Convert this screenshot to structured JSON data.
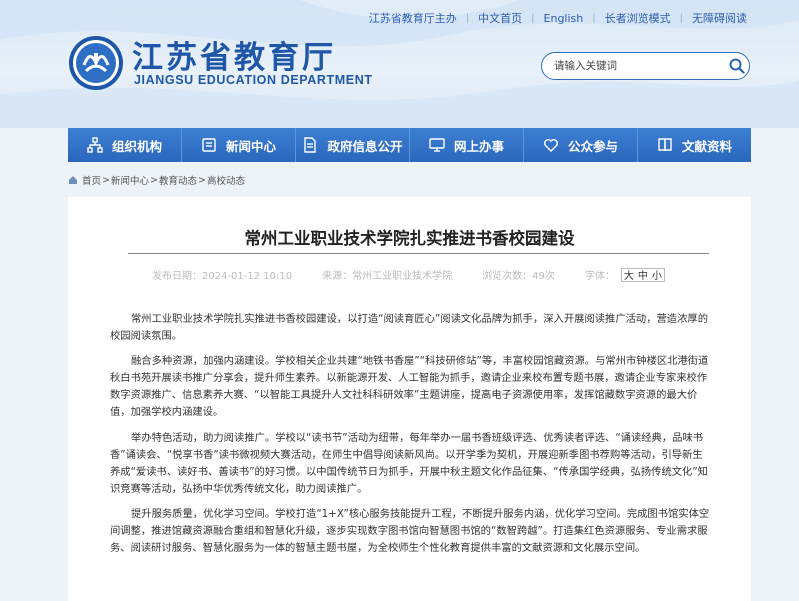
{
  "topbar": {
    "links": [
      "江苏省教育厅主办",
      "中文首页",
      "English",
      "长者浏览模式",
      "无障碍阅读"
    ]
  },
  "logo": {
    "title": "江苏省教育厅",
    "subtitle": "JIANGSU EDUCATION DEPARTMENT",
    "emblem_icon": "jiangsu-education-emblem-icon"
  },
  "search": {
    "placeholder": "请输入关键词"
  },
  "nav": {
    "items": [
      {
        "label": "组织机构",
        "icon": "org-chart-icon"
      },
      {
        "label": "新闻中心",
        "icon": "news-icon"
      },
      {
        "label": "政府信息公开",
        "icon": "document-icon"
      },
      {
        "label": "网上办事",
        "icon": "monitor-icon"
      },
      {
        "label": "公众参与",
        "icon": "heart-icon"
      },
      {
        "label": "文献资料",
        "icon": "book-icon"
      }
    ]
  },
  "breadcrumb": [
    "首页",
    "新闻中心",
    "教育动态",
    "高校动态"
  ],
  "article": {
    "title": "常州工业职业技术学院扎实推进书香校园建设",
    "meta": {
      "date": "发布日期：2024-01-12 10:10",
      "source": "来源：常州工业职业技术学院",
      "views": "浏览次数：49次",
      "font_label": "字体：",
      "font_sizes": [
        "大",
        "中",
        "小"
      ]
    },
    "paragraphs": [
      "常州工业职业技术学院扎实推进书香校园建设，以打造“阅读育匠心”阅读文化品牌为抓手，深入开展阅读推广活动，营造浓厚的校园阅读氛围。",
      "融合多种资源，加强内涵建设。学校相关企业共建“地铁书香屋”“科技研修站”等，丰富校园馆藏资源。与常州市钟楼区北港街道秋白书苑开展读书推广分享会，提升师生素养。以新能源开发、人工智能为抓手，邀请企业来校布置专题书展，邀请企业专家来校作数字资源推广、信息素养大赛、“以智能工具提升人文社科科研效率”主题讲座，提高电子资源使用率，发挥馆藏数字资源的最大价值，加强学校内涵建设。",
      "举办特色活动，助力阅读推广。学校以“读书节”活动为纽带，每年举办一届书香班级评选、优秀读者评选、“诵读经典，品味书香”诵读会、“悦享书香”读书微视频大赛活动，在师生中倡导阅读新风尚。以开学季为契机，开展迎新季图书荐购等活动，引导新生养成“爱读书、读好书、善读书”的好习惯。以中国传统节日为抓手，开展中秋主题文化作品征集、“传承国学经典，弘扬传统文化”知识竞赛等活动，弘扬中华优秀传统文化，助力阅读推广。",
      "提升服务质量，优化学习空间。学校打造“1+X”核心服务技能提升工程，不断提升服务内涵，优化学习空间。完成图书馆实体空间调整，推进馆藏资源融合重组和智慧化升级，逐步实现数字图书馆向智慧图书馆的“数智跨越”。打造集红色资源服务、专业需求服务、阅读研讨服务、智慧化服务为一体的智慧主题书屋，为全校师生个性化教育提供丰富的文献资源和文化展示空间。"
    ]
  },
  "colors": {
    "brand_blue": "#1f57a8",
    "nav_blue": "#2a66bd",
    "page_bg": "#eef3f9"
  }
}
